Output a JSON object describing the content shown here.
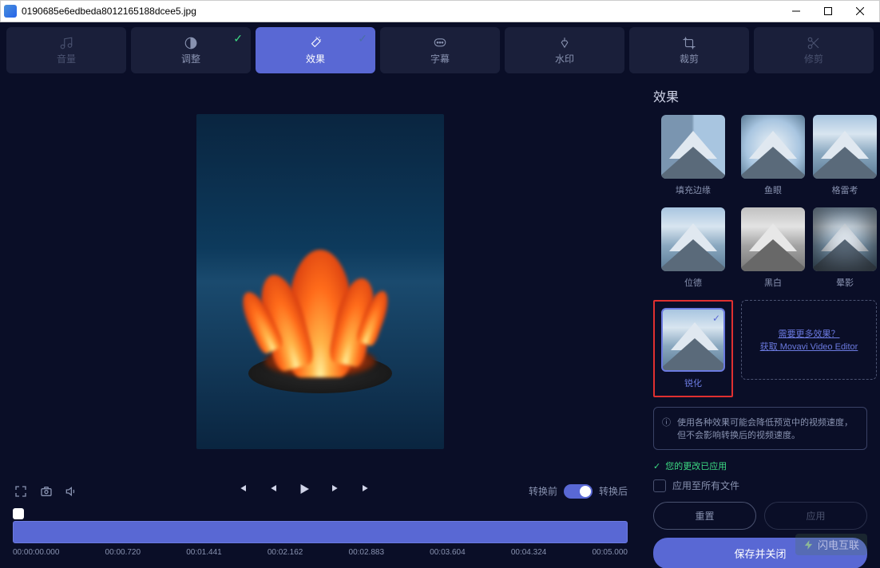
{
  "titlebar": {
    "filename": "0190685e6edbeda8012165188dcee5.jpg"
  },
  "toolbar": {
    "tabs": [
      {
        "label": "音量",
        "icon": "volume"
      },
      {
        "label": "调整",
        "icon": "contrast",
        "checked": true
      },
      {
        "label": "效果",
        "icon": "wand",
        "active": true,
        "checked": true
      },
      {
        "label": "字幕",
        "icon": "subtitle"
      },
      {
        "label": "水印",
        "icon": "stamp"
      },
      {
        "label": "裁剪",
        "icon": "crop"
      },
      {
        "label": "修剪",
        "icon": "trim"
      }
    ]
  },
  "preview": {
    "before_label": "转换前",
    "after_label": "转换后"
  },
  "timeline": {
    "current": "00:00:00.000",
    "ticks": [
      "00:00:00.000",
      "00:00.720",
      "00:01.441",
      "00:02.162",
      "00:02.883",
      "00:03.604",
      "00:04.324",
      "00:05.000"
    ]
  },
  "effects_panel": {
    "title": "效果",
    "items": [
      {
        "label": "填充边缘"
      },
      {
        "label": "鱼眼"
      },
      {
        "label": "格雷考"
      },
      {
        "label": "位德"
      },
      {
        "label": "黑白"
      },
      {
        "label": "晕影"
      },
      {
        "label": "锐化",
        "selected": true
      }
    ],
    "more_line1": "需要更多效果？",
    "more_line2": "获取 Movavi Video Editor",
    "info_text": "使用各种效果可能会降低预览中的视频速度，但不会影响转换后的视频速度。",
    "applied_text": "您的更改已应用",
    "apply_all_label": "应用至所有文件",
    "reset_btn": "重置",
    "apply_btn": "应用",
    "save_close_btn": "保存并关闭"
  },
  "watermark": {
    "text": "闪电互联"
  }
}
